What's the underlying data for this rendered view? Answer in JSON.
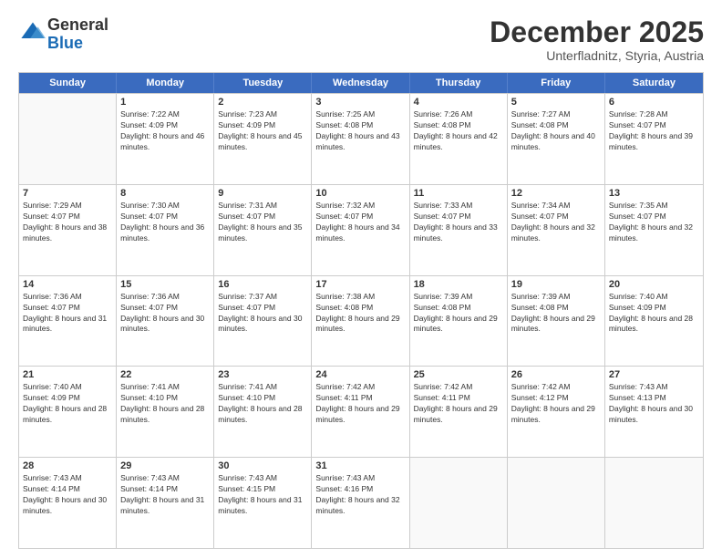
{
  "logo": {
    "general": "General",
    "blue": "Blue"
  },
  "header": {
    "month": "December 2025",
    "location": "Unterfladnitz, Styria, Austria"
  },
  "days": [
    "Sunday",
    "Monday",
    "Tuesday",
    "Wednesday",
    "Thursday",
    "Friday",
    "Saturday"
  ],
  "weeks": [
    [
      {
        "day": "",
        "sunrise": "",
        "sunset": "",
        "daylight": ""
      },
      {
        "day": "1",
        "sunrise": "Sunrise: 7:22 AM",
        "sunset": "Sunset: 4:09 PM",
        "daylight": "Daylight: 8 hours and 46 minutes."
      },
      {
        "day": "2",
        "sunrise": "Sunrise: 7:23 AM",
        "sunset": "Sunset: 4:09 PM",
        "daylight": "Daylight: 8 hours and 45 minutes."
      },
      {
        "day": "3",
        "sunrise": "Sunrise: 7:25 AM",
        "sunset": "Sunset: 4:08 PM",
        "daylight": "Daylight: 8 hours and 43 minutes."
      },
      {
        "day": "4",
        "sunrise": "Sunrise: 7:26 AM",
        "sunset": "Sunset: 4:08 PM",
        "daylight": "Daylight: 8 hours and 42 minutes."
      },
      {
        "day": "5",
        "sunrise": "Sunrise: 7:27 AM",
        "sunset": "Sunset: 4:08 PM",
        "daylight": "Daylight: 8 hours and 40 minutes."
      },
      {
        "day": "6",
        "sunrise": "Sunrise: 7:28 AM",
        "sunset": "Sunset: 4:07 PM",
        "daylight": "Daylight: 8 hours and 39 minutes."
      }
    ],
    [
      {
        "day": "7",
        "sunrise": "Sunrise: 7:29 AM",
        "sunset": "Sunset: 4:07 PM",
        "daylight": "Daylight: 8 hours and 38 minutes."
      },
      {
        "day": "8",
        "sunrise": "Sunrise: 7:30 AM",
        "sunset": "Sunset: 4:07 PM",
        "daylight": "Daylight: 8 hours and 36 minutes."
      },
      {
        "day": "9",
        "sunrise": "Sunrise: 7:31 AM",
        "sunset": "Sunset: 4:07 PM",
        "daylight": "Daylight: 8 hours and 35 minutes."
      },
      {
        "day": "10",
        "sunrise": "Sunrise: 7:32 AM",
        "sunset": "Sunset: 4:07 PM",
        "daylight": "Daylight: 8 hours and 34 minutes."
      },
      {
        "day": "11",
        "sunrise": "Sunrise: 7:33 AM",
        "sunset": "Sunset: 4:07 PM",
        "daylight": "Daylight: 8 hours and 33 minutes."
      },
      {
        "day": "12",
        "sunrise": "Sunrise: 7:34 AM",
        "sunset": "Sunset: 4:07 PM",
        "daylight": "Daylight: 8 hours and 32 minutes."
      },
      {
        "day": "13",
        "sunrise": "Sunrise: 7:35 AM",
        "sunset": "Sunset: 4:07 PM",
        "daylight": "Daylight: 8 hours and 32 minutes."
      }
    ],
    [
      {
        "day": "14",
        "sunrise": "Sunrise: 7:36 AM",
        "sunset": "Sunset: 4:07 PM",
        "daylight": "Daylight: 8 hours and 31 minutes."
      },
      {
        "day": "15",
        "sunrise": "Sunrise: 7:36 AM",
        "sunset": "Sunset: 4:07 PM",
        "daylight": "Daylight: 8 hours and 30 minutes."
      },
      {
        "day": "16",
        "sunrise": "Sunrise: 7:37 AM",
        "sunset": "Sunset: 4:07 PM",
        "daylight": "Daylight: 8 hours and 30 minutes."
      },
      {
        "day": "17",
        "sunrise": "Sunrise: 7:38 AM",
        "sunset": "Sunset: 4:08 PM",
        "daylight": "Daylight: 8 hours and 29 minutes."
      },
      {
        "day": "18",
        "sunrise": "Sunrise: 7:39 AM",
        "sunset": "Sunset: 4:08 PM",
        "daylight": "Daylight: 8 hours and 29 minutes."
      },
      {
        "day": "19",
        "sunrise": "Sunrise: 7:39 AM",
        "sunset": "Sunset: 4:08 PM",
        "daylight": "Daylight: 8 hours and 29 minutes."
      },
      {
        "day": "20",
        "sunrise": "Sunrise: 7:40 AM",
        "sunset": "Sunset: 4:09 PM",
        "daylight": "Daylight: 8 hours and 28 minutes."
      }
    ],
    [
      {
        "day": "21",
        "sunrise": "Sunrise: 7:40 AM",
        "sunset": "Sunset: 4:09 PM",
        "daylight": "Daylight: 8 hours and 28 minutes."
      },
      {
        "day": "22",
        "sunrise": "Sunrise: 7:41 AM",
        "sunset": "Sunset: 4:10 PM",
        "daylight": "Daylight: 8 hours and 28 minutes."
      },
      {
        "day": "23",
        "sunrise": "Sunrise: 7:41 AM",
        "sunset": "Sunset: 4:10 PM",
        "daylight": "Daylight: 8 hours and 28 minutes."
      },
      {
        "day": "24",
        "sunrise": "Sunrise: 7:42 AM",
        "sunset": "Sunset: 4:11 PM",
        "daylight": "Daylight: 8 hours and 29 minutes."
      },
      {
        "day": "25",
        "sunrise": "Sunrise: 7:42 AM",
        "sunset": "Sunset: 4:11 PM",
        "daylight": "Daylight: 8 hours and 29 minutes."
      },
      {
        "day": "26",
        "sunrise": "Sunrise: 7:42 AM",
        "sunset": "Sunset: 4:12 PM",
        "daylight": "Daylight: 8 hours and 29 minutes."
      },
      {
        "day": "27",
        "sunrise": "Sunrise: 7:43 AM",
        "sunset": "Sunset: 4:13 PM",
        "daylight": "Daylight: 8 hours and 30 minutes."
      }
    ],
    [
      {
        "day": "28",
        "sunrise": "Sunrise: 7:43 AM",
        "sunset": "Sunset: 4:14 PM",
        "daylight": "Daylight: 8 hours and 30 minutes."
      },
      {
        "day": "29",
        "sunrise": "Sunrise: 7:43 AM",
        "sunset": "Sunset: 4:14 PM",
        "daylight": "Daylight: 8 hours and 31 minutes."
      },
      {
        "day": "30",
        "sunrise": "Sunrise: 7:43 AM",
        "sunset": "Sunset: 4:15 PM",
        "daylight": "Daylight: 8 hours and 31 minutes."
      },
      {
        "day": "31",
        "sunrise": "Sunrise: 7:43 AM",
        "sunset": "Sunset: 4:16 PM",
        "daylight": "Daylight: 8 hours and 32 minutes."
      },
      {
        "day": "",
        "sunrise": "",
        "sunset": "",
        "daylight": ""
      },
      {
        "day": "",
        "sunrise": "",
        "sunset": "",
        "daylight": ""
      },
      {
        "day": "",
        "sunrise": "",
        "sunset": "",
        "daylight": ""
      }
    ]
  ]
}
